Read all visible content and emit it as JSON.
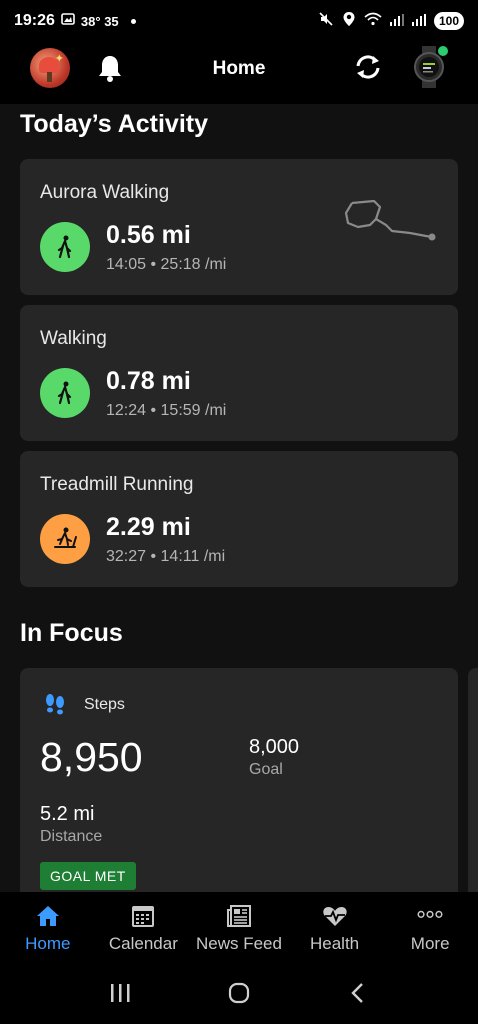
{
  "status_bar": {
    "time": "19:26",
    "temperature": "38° 35",
    "battery": "100"
  },
  "header": {
    "title": "Home"
  },
  "todays_activity": {
    "title": "Today’s Activity",
    "activities": [
      {
        "name": "Aurora Walking",
        "distance": "0.56 mi",
        "meta": "14:05 • 25:18 /mi",
        "icon": "walking-icon",
        "color": "#5ad96b"
      },
      {
        "name": "Walking",
        "distance": "0.78 mi",
        "meta": "12:24 • 15:59 /mi",
        "icon": "walking-icon",
        "color": "#5ad96b"
      },
      {
        "name": "Treadmill Running",
        "distance": "2.29 mi",
        "meta": "32:27 • 14:11 /mi",
        "icon": "treadmill-icon",
        "color": "#ff9f43"
      }
    ]
  },
  "in_focus": {
    "title": "In Focus",
    "steps": {
      "label": "Steps",
      "value": "8,950",
      "goal_value": "8,000",
      "goal_label": "Goal",
      "distance_value": "5.2 mi",
      "distance_label": "Distance",
      "badge": "GOAL MET"
    }
  },
  "bottom_nav": {
    "items": [
      {
        "label": "Home",
        "icon": "home-icon",
        "active": true
      },
      {
        "label": "Calendar",
        "icon": "calendar-icon",
        "active": false
      },
      {
        "label": "News Feed",
        "icon": "news-feed-icon",
        "active": false
      },
      {
        "label": "Health",
        "icon": "health-icon",
        "active": false
      },
      {
        "label": "More",
        "icon": "more-icon",
        "active": false
      }
    ]
  },
  "colors": {
    "accent": "#3d9bff",
    "walk_green": "#5ad96b",
    "run_orange": "#ff9f43",
    "goal_badge": "#1e7e34"
  }
}
